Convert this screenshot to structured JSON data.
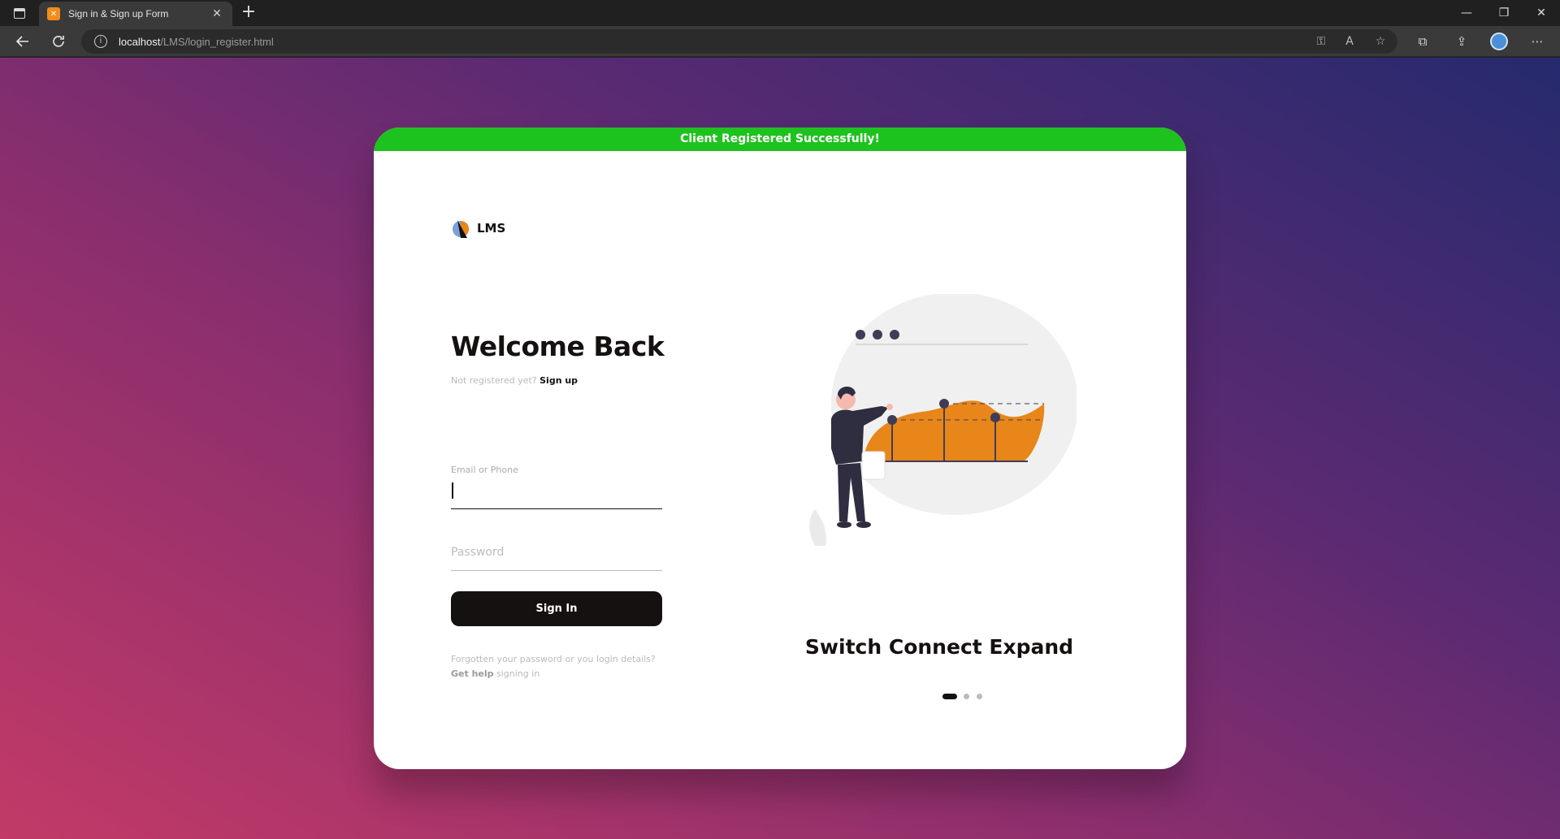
{
  "browser": {
    "tab_title": "Sign in & Sign up Form",
    "tab_close": "✕",
    "new_tab": "+",
    "url_host": "localhost",
    "url_path": "/LMS/login_register.html",
    "win_min": "—",
    "win_max": "❐",
    "win_close": "✕",
    "accent": "#4a90d9"
  },
  "banner": {
    "text": "Client Registered Successfully!",
    "color": "#1ec21e"
  },
  "logo": {
    "text": "LMS"
  },
  "login": {
    "heading": "Welcome Back",
    "not_registered": "Not registered yet? ",
    "signup_link": "Sign up",
    "email_label": "Email or Phone",
    "password_placeholder": "Password",
    "signin_button": "Sign In",
    "help_line1": "Forgotten your password or you login details?",
    "help_get_help": "Get help",
    "help_signing_in": " signing in"
  },
  "carousel": {
    "slogan": "Switch Connect Expand",
    "active_index": 0,
    "count": 3,
    "accent": "#e8861a"
  }
}
